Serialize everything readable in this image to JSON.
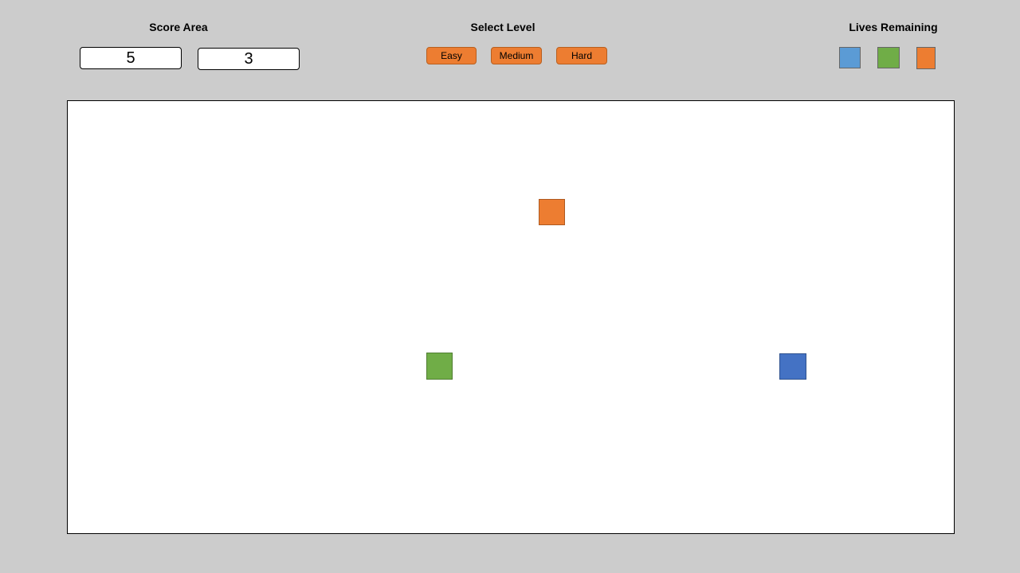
{
  "score_area": {
    "title": "Score Area",
    "scores": [
      "5",
      "3"
    ]
  },
  "level_select": {
    "title": "Select Level",
    "buttons": [
      "Easy",
      "Medium",
      "Hard"
    ],
    "button_color": "#ed7d31"
  },
  "lives": {
    "title": "Lives Remaining",
    "count": 3,
    "colors": [
      "#5b9bd5",
      "#70ad47",
      "#ed7d31"
    ]
  },
  "play_area": {
    "background": "#ffffff",
    "pieces": [
      {
        "name": "orange-square",
        "color": "#ed7d31",
        "border": "#ae5a21"
      },
      {
        "name": "green-square",
        "color": "#70ad47",
        "border": "#507e32"
      },
      {
        "name": "blue-square",
        "color": "#4472c4",
        "border": "#2f528f"
      }
    ]
  }
}
